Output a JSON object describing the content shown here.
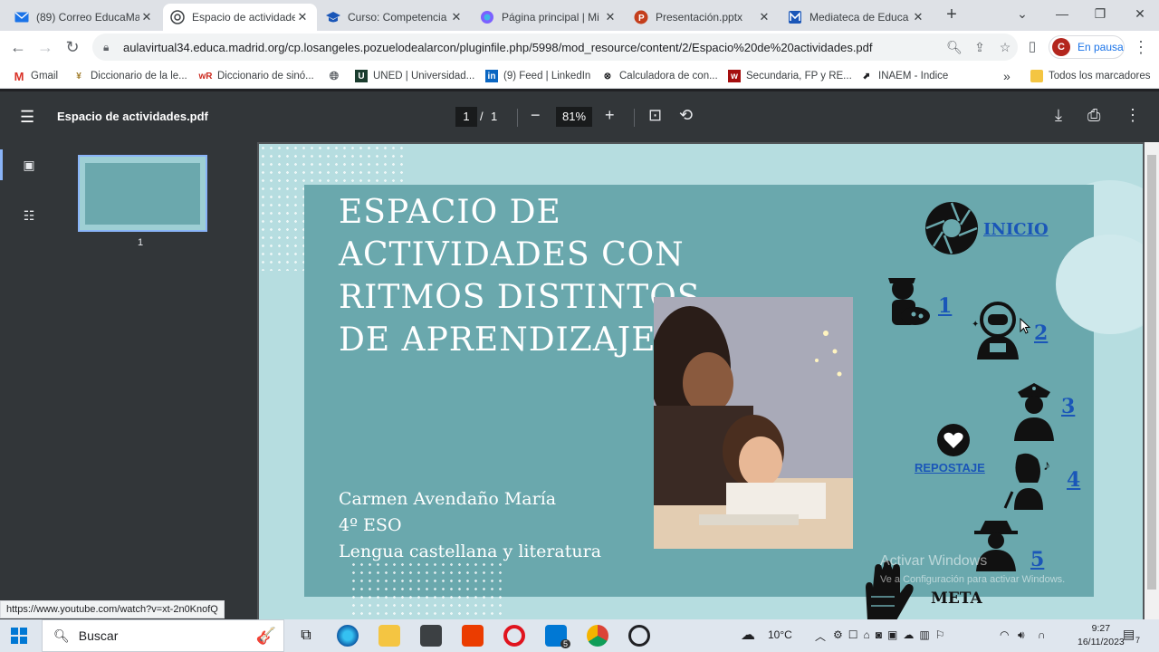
{
  "browser": {
    "tabs": [
      {
        "label": "(89) Correo EducaMa",
        "icon": "mail-icon",
        "color": "#1a73e8"
      },
      {
        "label": "Espacio de actividade",
        "icon": "chrome-pdf-icon",
        "color": "#d93025"
      },
      {
        "label": "Curso: Competencia",
        "icon": "graduation-cap-icon",
        "color": "#1a56b8"
      },
      {
        "label": "Página principal | Mi",
        "icon": "copilot-icon",
        "color": "#7b61ff"
      },
      {
        "label": "Presentación.pptx",
        "icon": "powerpoint-icon",
        "color": "#c43e1c"
      },
      {
        "label": "Mediateca de Educa",
        "icon": "mediateca-icon",
        "color": "#1a56b8"
      }
    ],
    "url": "aulavirtual34.educa.madrid.org/cp.losangeles.pozuelodealarcon/pluginfile.php/5998/mod_resource/content/2/Espacio%20de%20actividades.pdf",
    "profile_status": "En pausa",
    "profile_initial": "C",
    "bookmarks": [
      {
        "label": "Gmail",
        "icon": "gmail-icon",
        "color": "#d93025"
      },
      {
        "label": "Diccionario de la le...",
        "icon": "rae-icon",
        "color": "#a07c2a"
      },
      {
        "label": "Diccionario de sinó...",
        "icon": "wr-icon",
        "color": "#cc2a1f"
      },
      {
        "label": "",
        "icon": "globe-icon",
        "color": "#5f6368"
      },
      {
        "label": "UNED | Universidad...",
        "icon": "uned-icon",
        "color": "#1b3d2f"
      },
      {
        "label": "(9) Feed | LinkedIn",
        "icon": "linkedin-icon",
        "color": "#0a66c2"
      },
      {
        "label": "Calculadora de con...",
        "icon": "calc-icon",
        "color": "#202124"
      },
      {
        "label": "Secundaria, FP y RE...",
        "icon": "boe-icon",
        "color": "#a50e0e"
      },
      {
        "label": "INAEM - Indice",
        "icon": "inaem-icon",
        "color": "#202124"
      }
    ],
    "bookmarks_more": "»",
    "all_bookmarks": "Todos los marcadores"
  },
  "pdf": {
    "title": "Espacio de actividades.pdf",
    "page_current": "1",
    "page_sep": "/",
    "page_total": "1",
    "zoom": "81%",
    "thumb_number": "1"
  },
  "slide": {
    "title": "ESPACIO DE ACTIVIDADES CON RITMOS DISTINTOS DE APRENDIZAJE",
    "author_lines": [
      "Carmen Avendaño María",
      "4º ESO",
      "Lengua castellana y literatura"
    ],
    "inicio": "INICIO",
    "repostaje": "REPOSTAJE",
    "meta": "META",
    "stations": [
      "1",
      "2",
      "3",
      "4",
      "5"
    ],
    "watermark": "Activar Windows",
    "watermark_sub": "Ve a Configuración para activar Windows."
  },
  "status_url": "https://www.youtube.com/watch?v=xt-2n0KnofQ",
  "taskbar": {
    "search": "Buscar",
    "temperature": "10°C",
    "time": "9:27",
    "date": "16/11/2023",
    "notif_count": "7",
    "mail_badge": "5"
  }
}
